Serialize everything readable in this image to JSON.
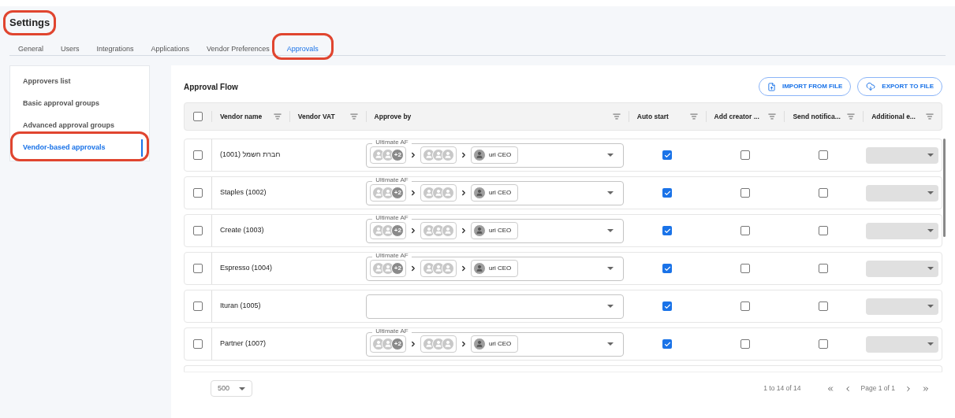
{
  "title": {
    "text": "Settings",
    "annotated": true
  },
  "tabs": [
    {
      "label": "General",
      "selected": false,
      "annotated": false
    },
    {
      "label": "Users",
      "selected": false,
      "annotated": false
    },
    {
      "label": "Integrations",
      "selected": false,
      "annotated": false
    },
    {
      "label": "Applications",
      "selected": false,
      "annotated": false
    },
    {
      "label": "Vendor Preferences",
      "selected": false,
      "annotated": false
    },
    {
      "label": "Approvals",
      "selected": true,
      "annotated": true
    }
  ],
  "sidebar": {
    "items": [
      {
        "label": "Approvers list",
        "selected": false,
        "annotated": false
      },
      {
        "label": "Basic approval groups",
        "selected": false,
        "annotated": false
      },
      {
        "label": "Advanced approval groups",
        "selected": false,
        "annotated": false
      },
      {
        "label": "Vendor-based approvals",
        "selected": true,
        "annotated": true
      }
    ]
  },
  "panel": {
    "title": "Approval Flow",
    "buttons": [
      {
        "label": "IMPORT FROM FILE",
        "kind": "import"
      },
      {
        "label": "EXPORT TO FILE",
        "kind": "export"
      }
    ]
  },
  "table": {
    "columns": [
      "Vendor name",
      "Vendor VAT",
      "Approve by",
      "Auto start",
      "Add creator ...",
      "Send notifica...",
      "Additional e..."
    ],
    "header_checked": false,
    "rows": [
      {
        "checked": false,
        "vendor": "חברת חשמל (1001)",
        "approve_by": {
          "label": "Ultimate AF",
          "extra": "+2",
          "user": "uri CEO"
        },
        "auto_start": true,
        "add_creator": false,
        "send_notification": false
      },
      {
        "checked": false,
        "vendor": "Staples (1002)",
        "approve_by": {
          "label": "Ultimate AF",
          "extra": "+2",
          "user": "uri CEO"
        },
        "auto_start": true,
        "add_creator": false,
        "send_notification": false
      },
      {
        "checked": false,
        "vendor": "Create (1003)",
        "approve_by": {
          "label": "Ultimate AF",
          "extra": "+2",
          "user": "uri CEO"
        },
        "auto_start": true,
        "add_creator": false,
        "send_notification": false
      },
      {
        "checked": false,
        "vendor": "Espresso (1004)",
        "approve_by": {
          "label": "Ultimate AF",
          "extra": "+2",
          "user": "uri CEO"
        },
        "auto_start": true,
        "add_creator": false,
        "send_notification": false
      },
      {
        "checked": false,
        "vendor": "Ituran (1005)",
        "auto_start": true,
        "add_creator": false,
        "send_notification": false
      },
      {
        "checked": false,
        "vendor": "Partner (1007)",
        "approve_by": {
          "label": "Ultimate AF",
          "extra": "+2",
          "user": "uri CEO"
        },
        "auto_start": true,
        "add_creator": false,
        "send_notification": false
      }
    ]
  },
  "footer": {
    "page_size": "500",
    "range": "1 to 14 of 14",
    "page": "Page 1 of 1"
  }
}
